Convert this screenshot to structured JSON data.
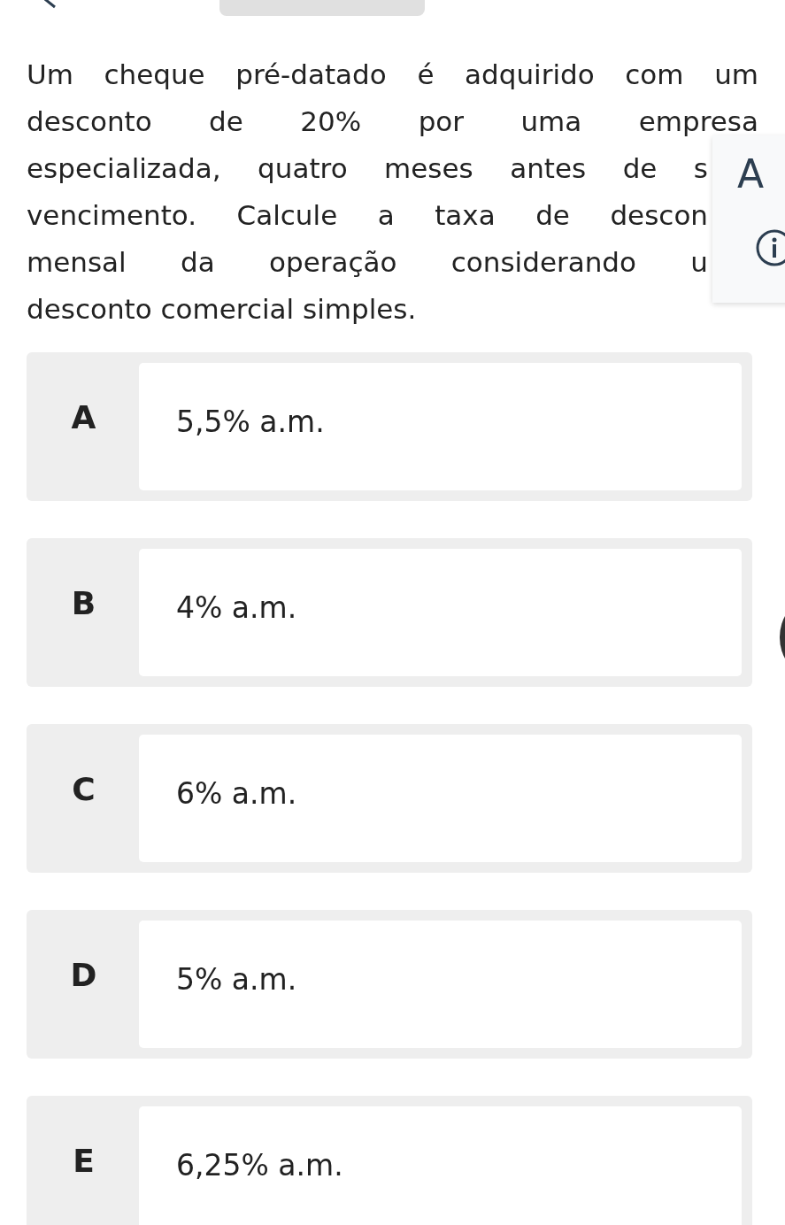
{
  "question": {
    "lines": [
      "Um cheque pré-datado é adquirido com um",
      "desconto de 20% por uma empresa",
      "especializada, quatro meses antes de s",
      "vencimento. Calcule a taxa de descon",
      "mensal da operação considerando u",
      "desconto comercial simples."
    ]
  },
  "side_panel": {
    "font_label": "A"
  },
  "options": [
    {
      "letter": "A",
      "text": "5,5% a.m.",
      "selected": false
    },
    {
      "letter": "B",
      "text": "4% a.m.",
      "selected": false
    },
    {
      "letter": "C",
      "text": "6% a.m.",
      "selected": false
    },
    {
      "letter": "D",
      "text": "5% a.m.",
      "selected": false
    },
    {
      "letter": "E",
      "text": "6,25% a.m.",
      "selected": false
    }
  ]
}
